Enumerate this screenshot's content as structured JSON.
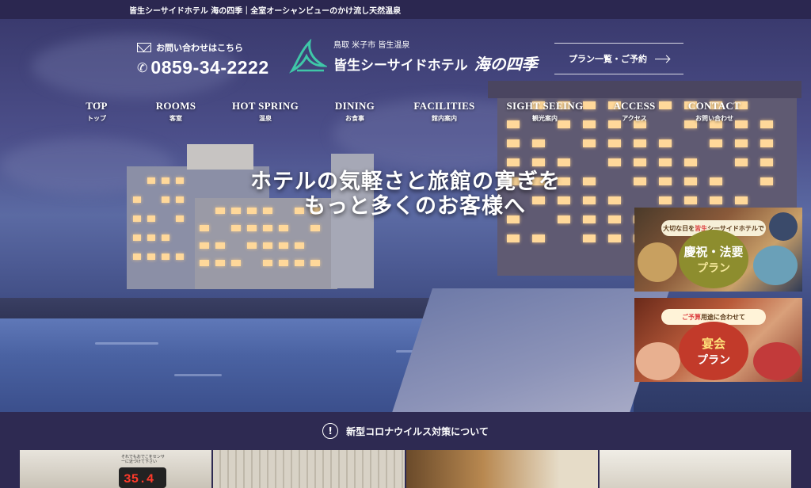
{
  "topbar": {
    "text": "皆生シーサイドホテル 海の四季｜全室オーシャンビューのかけ流し天然温泉"
  },
  "contact": {
    "mail_label": "お問い合わせはこちら",
    "phone": "0859-34-2222"
  },
  "logo": {
    "location": "鳥取 米子市 皆生温泉",
    "name": "皆生シーサイドホテル",
    "script_name": "海の四季"
  },
  "plan_button": {
    "label": "プラン一覧・ご予約"
  },
  "nav": [
    {
      "en": "TOP",
      "jp": "トップ"
    },
    {
      "en": "ROOMS",
      "jp": "客室"
    },
    {
      "en": "HOT SPRING",
      "jp": "温泉"
    },
    {
      "en": "DINING",
      "jp": "お食事"
    },
    {
      "en": "FACILITIES",
      "jp": "館内案内"
    },
    {
      "en": "SIGHT SEEING",
      "jp": "観光案内"
    },
    {
      "en": "ACCESS",
      "jp": "アクセス"
    },
    {
      "en": "CONTACT",
      "jp": "お問い合わせ"
    }
  ],
  "headline": {
    "line1": "ホテルの気軽さと旅館の寛ぎを",
    "line2": "もっと多くのお客様へ"
  },
  "banners": [
    {
      "badge_pre": "大切な日を",
      "badge_hl": "皆生",
      "badge_post": "シーサイドホテルで",
      "title": "慶祝・法要",
      "sub": "プラン"
    },
    {
      "badge_pre": "ご予算",
      "badge_hl": "",
      "badge_post": " 用途に合わせて",
      "title": "宴会",
      "sub": "プラン"
    }
  ],
  "notice": {
    "icon": "!",
    "text": "新型コロナウイルス対策について"
  },
  "thumbs": {
    "thermo_value": "35.4",
    "thermo_label": "それでもおでこをセンサーに近づけて下さい"
  },
  "colors": {
    "topbar_bg": "#2b2750",
    "page_bg": "#2e2a52",
    "window_light": "#ffd89a"
  }
}
